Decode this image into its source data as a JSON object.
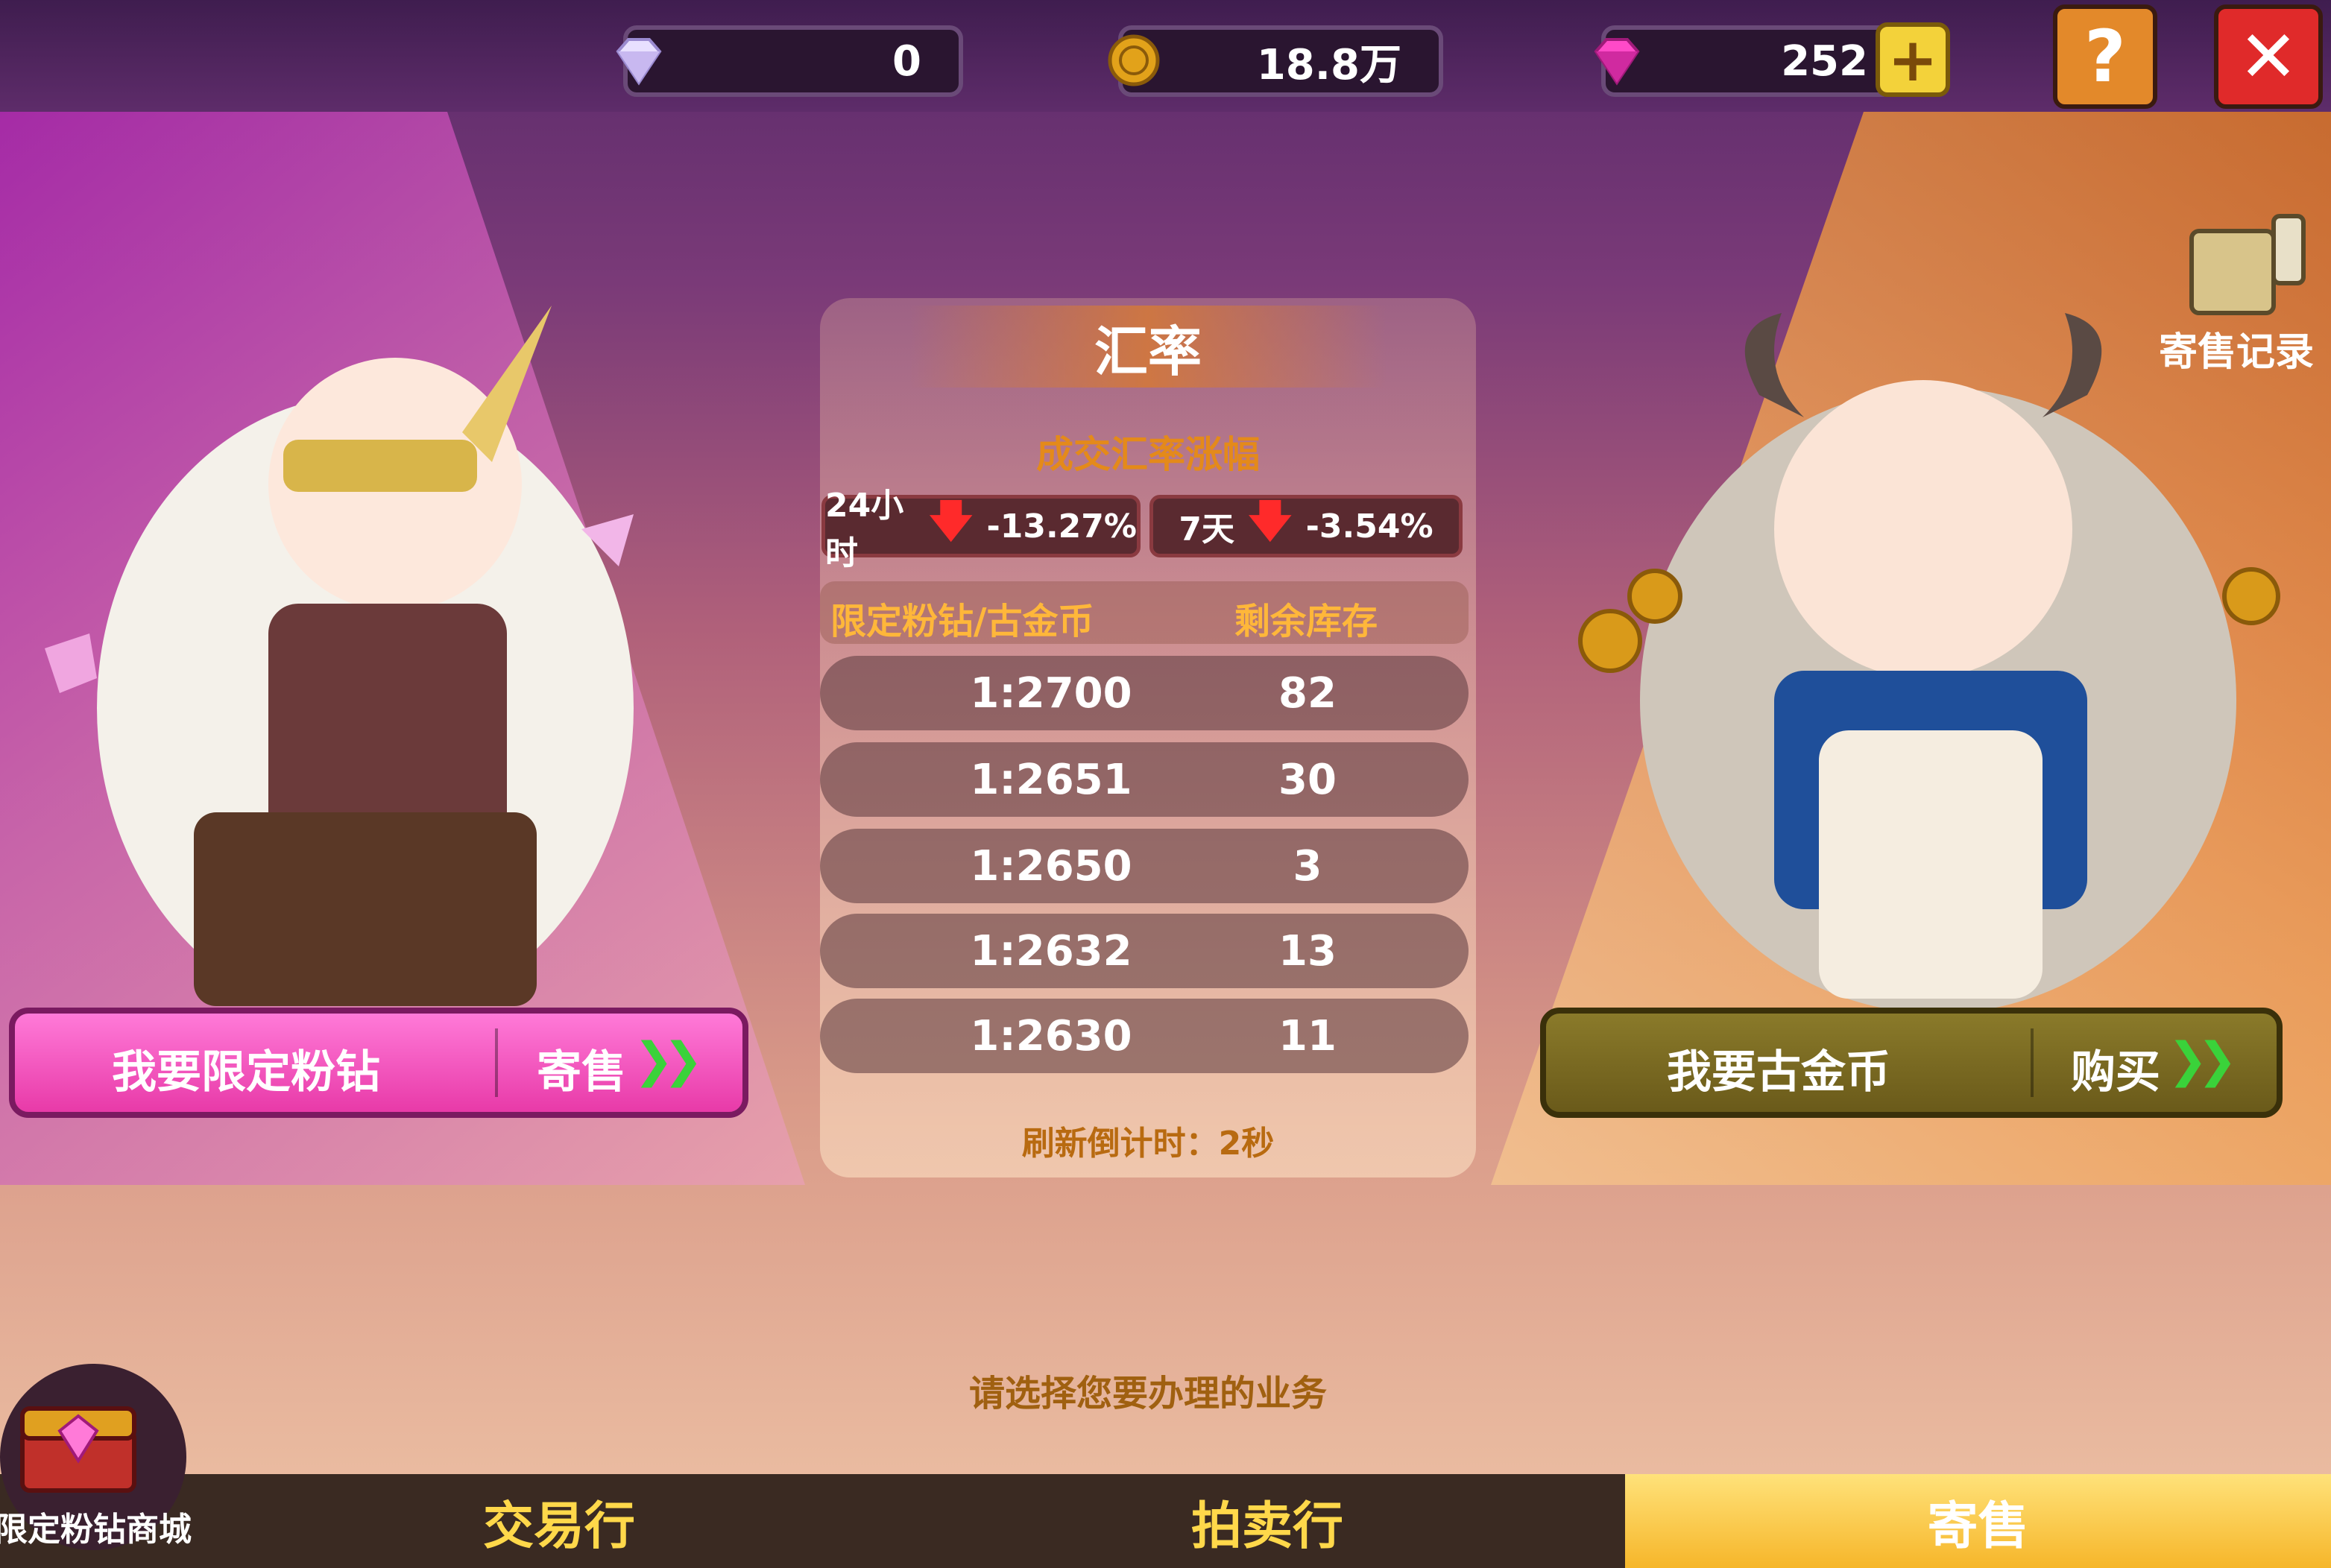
{
  "currencies": {
    "diamond": {
      "value": "0",
      "icon": "white-diamond-icon"
    },
    "gold": {
      "value": "18.8万",
      "icon": "gold-coin-icon"
    },
    "pink": {
      "value": "252",
      "icon": "pink-diamond-icon"
    }
  },
  "buttons": {
    "add": "+",
    "help": "?",
    "close": "✕"
  },
  "record": {
    "label": "寄售记录"
  },
  "exchange": {
    "title": "汇率",
    "subtitle": "成交汇率涨幅",
    "stats": [
      {
        "period": "24小时",
        "change": "-13.27%"
      },
      {
        "period": "7天",
        "change": "-3.54%"
      }
    ],
    "table": {
      "headers": [
        "限定粉钻/古金币",
        "剩余库存"
      ],
      "rows": [
        {
          "rate": "1:2700",
          "stock": "82"
        },
        {
          "rate": "1:2651",
          "stock": "30"
        },
        {
          "rate": "1:2650",
          "stock": "3"
        },
        {
          "rate": "1:2632",
          "stock": "13"
        },
        {
          "rate": "1:2630",
          "stock": "11"
        }
      ]
    },
    "countdown": "刷新倒计时：2秒"
  },
  "left_action": {
    "label": "我要限定粉钻",
    "action": "寄售"
  },
  "right_action": {
    "label": "我要古金币",
    "action": "购买"
  },
  "hint": "请选择您要办理的业务",
  "shop": {
    "label": "限定粉钻商城"
  },
  "tabs": [
    {
      "label": "交易行",
      "active": false
    },
    {
      "label": "拍卖行",
      "active": false
    },
    {
      "label": "寄售",
      "active": true
    }
  ],
  "colors": {
    "accent": "#f6b62a",
    "pink": "#e83aa8",
    "down": "#ff2a2a"
  }
}
